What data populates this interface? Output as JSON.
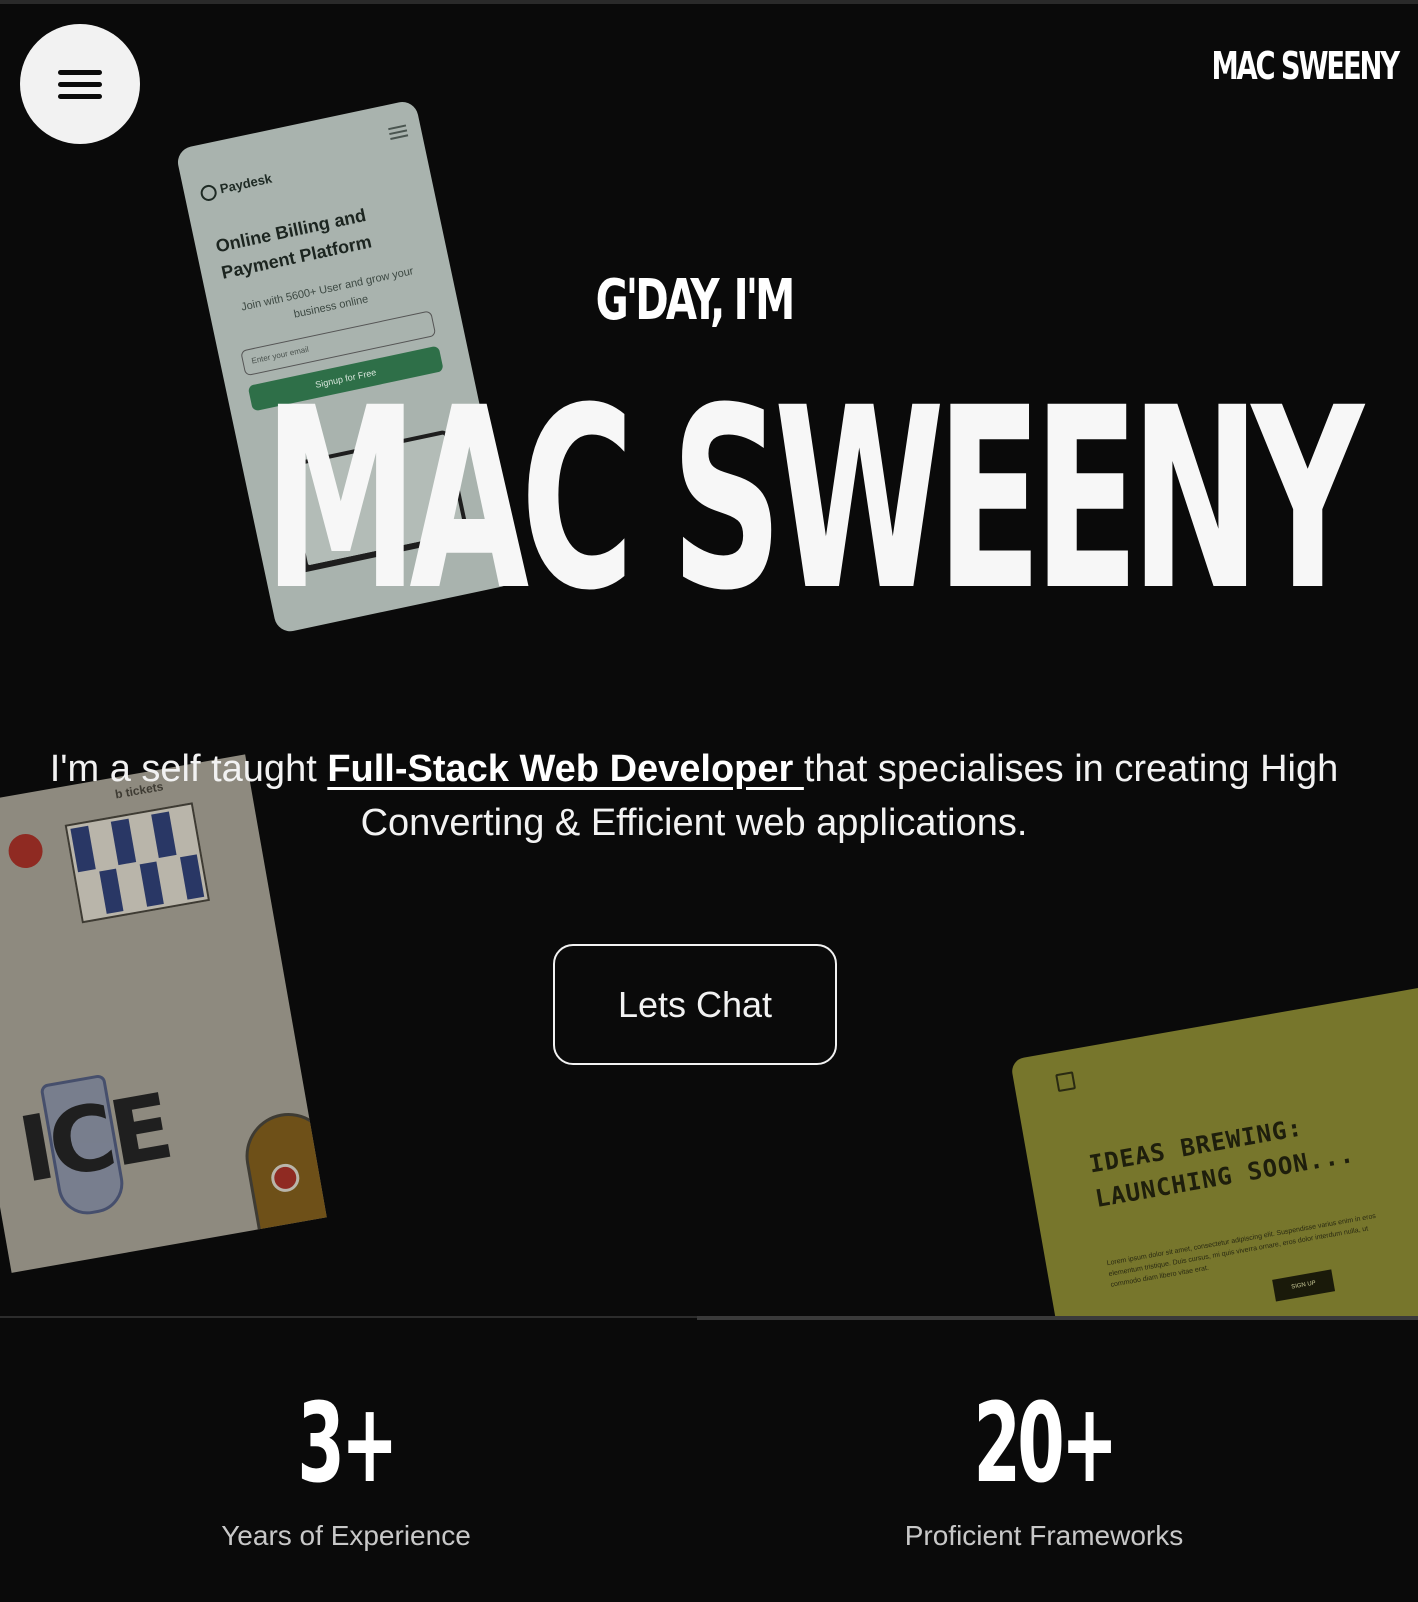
{
  "header": {
    "brand": "MAC SWEENY",
    "menu_icon": "hamburger-menu-icon"
  },
  "cards": {
    "paydesk": {
      "logo": "Paydesk",
      "headline": "Online Billing  and Payment  Platform",
      "subtitle": "Join with 5600+ User and grow your business online",
      "input_placeholder": "Enter your email",
      "cta": "Signup for Free"
    },
    "tickets": {
      "label": "b tickets",
      "big_text": "ICE"
    },
    "ideas": {
      "title": "IDEAS BREWING: LAUNCHING SOON...",
      "body": "Lorem ipsum dolor sit amet, consectetur adipiscing elit. Suspendisse varius enim in eros elementum tristique. Duis cursus, mi quis viverra ornare, eros dolor interdum nulla, ut commodo diam libero vitae erat.",
      "button": "SIGN UP"
    }
  },
  "hero": {
    "greeting": "G'DAY, I'M",
    "name": "MAC SWEENY",
    "intro_before": "I'm a self taught ",
    "intro_highlight": "Full-Stack Web Developer ",
    "intro_after": "that specialises in creating High Converting & Efficient web applications.",
    "cta_label": "Lets Chat"
  },
  "stats": [
    {
      "value": "3+",
      "label": "Years of Experience"
    },
    {
      "value": "20+",
      "label": "Proficient Frameworks"
    }
  ],
  "colors": {
    "background": "#0a0a0a",
    "text": "#f5f5f5",
    "paydesk_card": "#a9b3ae",
    "tickets_card": "#8e8a7f",
    "ideas_card": "#77762c"
  }
}
